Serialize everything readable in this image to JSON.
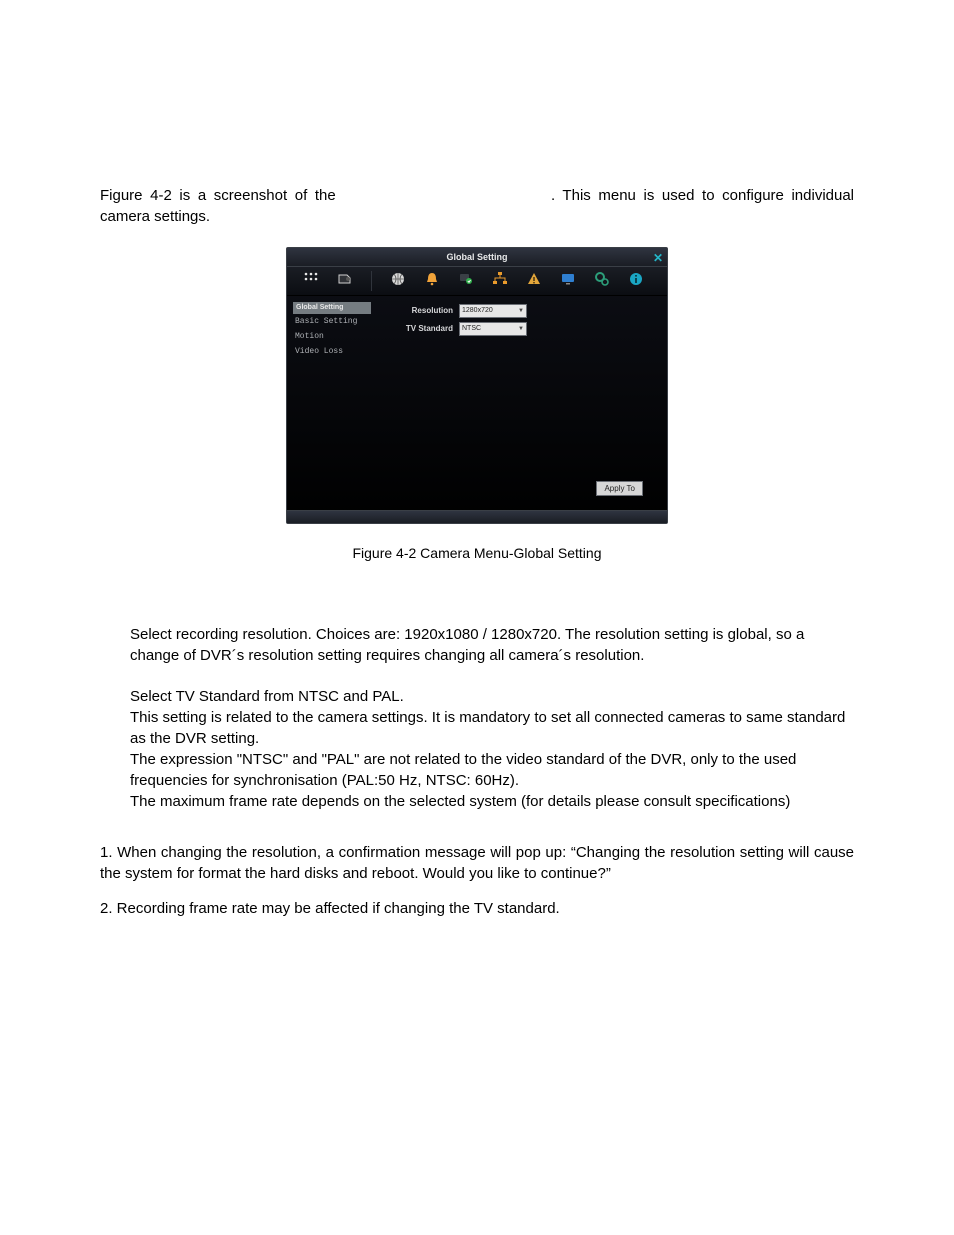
{
  "intro": {
    "p1a": "Figure 4-2 is a screenshot of the ",
    "p1b": ". This menu is used to configure individual camera settings."
  },
  "caption": "Figure 4-2 Camera Menu-Global Setting",
  "app": {
    "title": "Global Setting",
    "close": "✕",
    "sidebar": {
      "header": "Global Setting",
      "items": [
        "Basic Setting",
        "Motion",
        "Video Loss"
      ]
    },
    "form": {
      "resolution_label": "Resolution",
      "resolution_value": "1280x720",
      "tvstd_label": "TV Standard",
      "tvstd_value": "NTSC"
    },
    "apply_label": "Apply To"
  },
  "body": {
    "res": "Select recording resolution. Choices are: 1920x1080 / 1280x720. The resolution setting is global, so a change of DVR´s  resolution setting requires changing all camera´s resolution.",
    "tv1": "Select TV Standard from NTSC and PAL.",
    "tv2": "This setting is related to the camera settings. It is mandatory to set all connected cameras to same standard as the DVR setting.",
    "tv3": "The expression \"NTSC\" and \"PAL\" are not related to the video standard of the DVR, only to the used frequencies for synchronisation (PAL:50 Hz, NTSC: 60Hz).",
    "tv4": "The maximum frame rate depends on the selected system (for details please consult specifications)"
  },
  "notes": {
    "n1": "  1. When changing the resolution, a confirmation message will pop up: “Changing the resolution setting will cause the system for format the hard disks and reboot. Would you like to continue?”",
    "n2": "2.  Recording frame rate may be affected if changing the TV standard."
  }
}
